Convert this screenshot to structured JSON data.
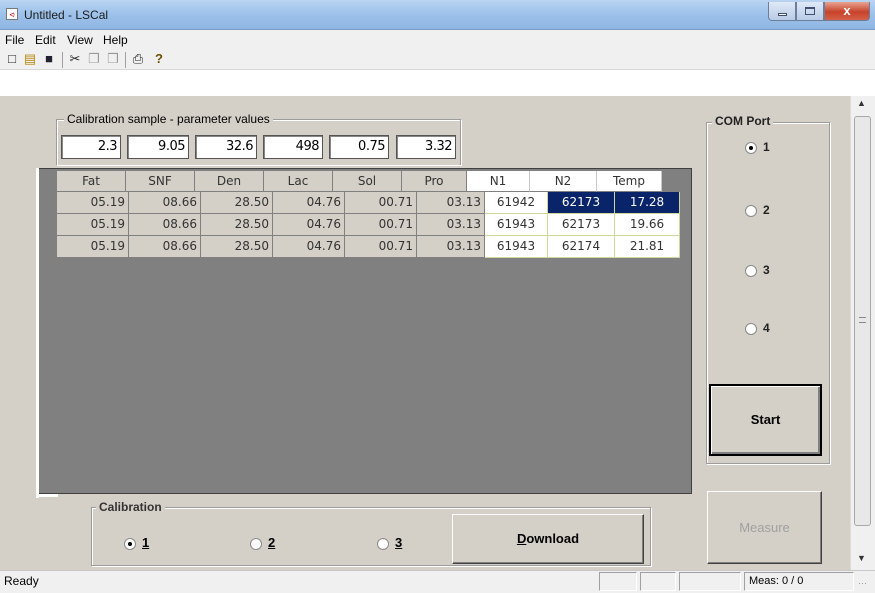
{
  "window": {
    "title": "Untitled - LSCal",
    "close_glyph": "x"
  },
  "menu": [
    "File",
    "Edit",
    "View",
    "Help"
  ],
  "toolbar": {
    "icons": [
      "new-file-icon",
      "open-folder-icon",
      "save-icon",
      "cut-icon",
      "copy-icon",
      "paste-icon",
      "print-icon",
      "help-icon"
    ],
    "glyphs": [
      "□",
      "▤",
      "■",
      "✂",
      "❐",
      "❒",
      "⎙",
      "?"
    ]
  },
  "params": {
    "group_label": "Calibration sample - parameter values",
    "values": [
      "2.3",
      "9.05",
      "32.6",
      "498",
      "0.75",
      "3.32"
    ]
  },
  "table": {
    "columns": [
      "Fat",
      "SNF",
      "Den",
      "Lac",
      "Sol",
      "Pro",
      "N1",
      "N2",
      "Temp"
    ],
    "rows": [
      [
        "05.19",
        "08.66",
        "28.50",
        "04.76",
        "00.71",
        "03.13",
        "61942",
        "62173",
        "17.28"
      ],
      [
        "05.19",
        "08.66",
        "28.50",
        "04.76",
        "00.71",
        "03.13",
        "61943",
        "62173",
        "19.66"
      ],
      [
        "05.19",
        "08.66",
        "28.50",
        "04.76",
        "00.71",
        "03.13",
        "61943",
        "62174",
        "21.81"
      ]
    ]
  },
  "calibration": {
    "label": "Calibration",
    "options": [
      "1",
      "2",
      "3"
    ],
    "selected": "1",
    "download_label": "Download",
    "download_underline": "D"
  },
  "com_port": {
    "label": "COM Port",
    "options": [
      "1",
      "2",
      "3",
      "4"
    ],
    "selected": "1",
    "start_label": "Start",
    "measure_label": "Measure"
  },
  "status": {
    "left": "Ready",
    "meas": "Meas: 0 / 0"
  },
  "colors": {
    "selection": "#0a246a",
    "panel": "#d4d0c8",
    "grid_bg": "#808080",
    "close_button": "#c7432a"
  }
}
